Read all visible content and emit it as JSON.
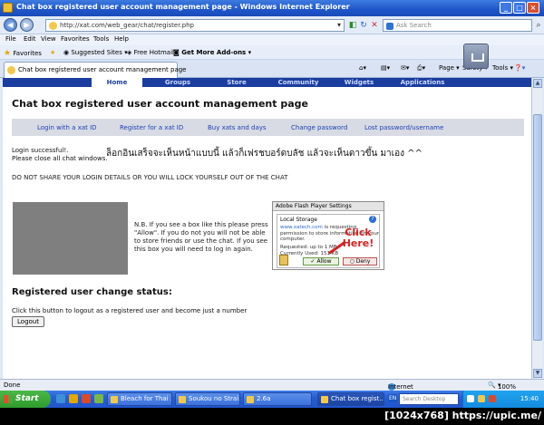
{
  "window": {
    "title": "Chat box registered user account management page - Windows Internet Explorer"
  },
  "address": {
    "url": "http://xat.com/web_gear/chat/register.php",
    "search_placeholder": "Ask Search"
  },
  "menu": [
    "File",
    "Edit",
    "View",
    "Favorites",
    "Tools",
    "Help"
  ],
  "favorites_bar": {
    "favorites": "Favorites",
    "suggested": "Suggested Sites",
    "hotmail": "Free Hotmail",
    "addons": "Get More Add-ons"
  },
  "tab": {
    "label": "Chat box registered user account management page"
  },
  "commands": {
    "page": "Page",
    "safety": "Safety",
    "tools": "Tools"
  },
  "site_nav": [
    "Home",
    "Groups",
    "Store",
    "Community",
    "Widgets",
    "Applications"
  ],
  "page": {
    "title": "Chat box registered user account management page",
    "subnav": [
      "Login with a xat ID",
      "Register for a xat ID",
      "Buy xats and days",
      "Change password",
      "Lost password/username"
    ],
    "login_success": "Login successful!.",
    "close_windows": "Please close all chat windows.",
    "thai_note": "ล็อกอินเสร็จจะเห็นหน้าแบบนี้ แล้วก็เฟรชบอร์ดบลัช แล้วจะเห็นดาวขึ้น มาเอง ^^",
    "warning": "DO NOT SHARE YOUR LOGIN DETAILS OR YOU WILL LOCK YOURSELF OUT OF THE CHAT",
    "nb_text": "N.B. If you see a box like this please press \"Allow\". If you do not you will not be able to store friends or use the chat. If you see this box you will need to log in again.",
    "flash": {
      "header": "Adobe Flash Player Settings",
      "section": "Local Storage",
      "site": "www.xatech.com",
      "msg_rest": " is requesting permission to store information on your computer.",
      "requested": "Requested: up to 1 MB",
      "currently": "Currently Used: 151 KB",
      "allow": "Allow",
      "deny": "Deny",
      "help": "?"
    },
    "click_here": "Click Here!",
    "status_heading": "Registered user change status:",
    "logout_text": "Click this button to logout as a registered user and become just a number",
    "logout_button": "Logout"
  },
  "status_bar": {
    "left": "Done",
    "zone": "Internet",
    "zoom": "100%"
  },
  "taskbar": {
    "start": "Start",
    "tasks": [
      "Bleach for Thai ...",
      "Soukou no Strai...",
      "2.6a",
      "Chat box regist..."
    ],
    "lang": "EN",
    "search_placeholder": "Search Desktop",
    "clock": "15:40"
  },
  "watermark": "[1024x768] https://upic.me/"
}
